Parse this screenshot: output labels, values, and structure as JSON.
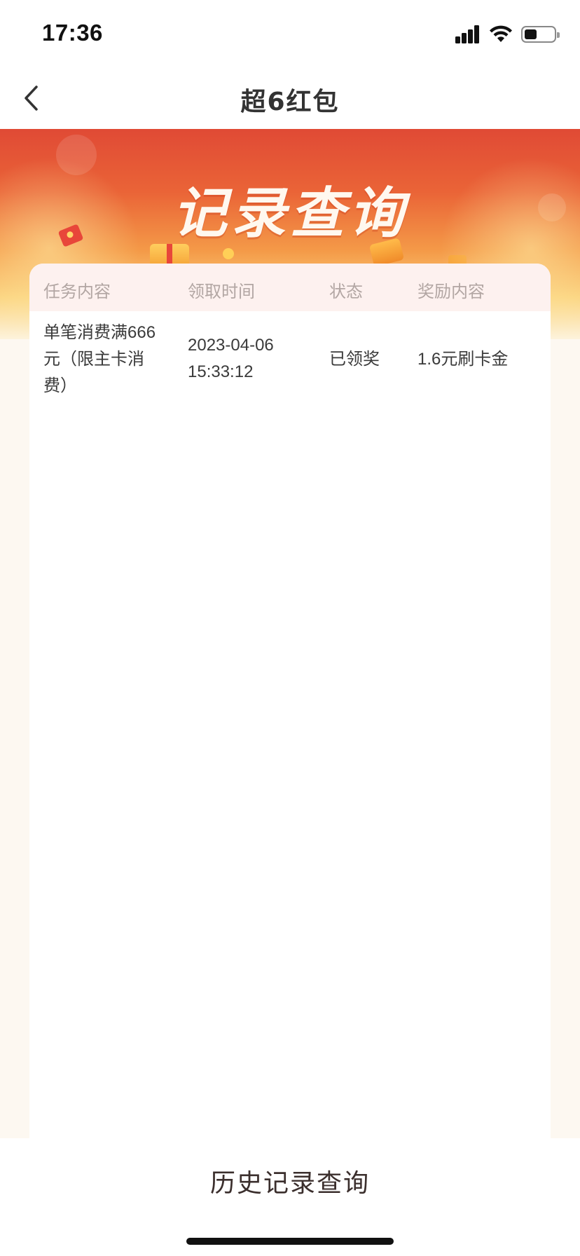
{
  "status_bar": {
    "time": "17:36",
    "icons": [
      "cellular-signal-icon",
      "wifi-icon",
      "battery-icon"
    ]
  },
  "nav": {
    "title": "超6红包",
    "back_icon": "chevron-left-icon"
  },
  "banner": {
    "title": "记录查询"
  },
  "table": {
    "headers": [
      "任务内容",
      "领取时间",
      "状态",
      "奖励内容"
    ],
    "rows": [
      {
        "task": "单笔消费满666元（限主卡消费）",
        "time": "2023-04-06 15:33:12",
        "status": "已领奖",
        "reward": "1.6元刷卡金"
      }
    ]
  },
  "footer": {
    "history_button": "历史记录查询"
  },
  "colors": {
    "banner_red": "#e04a35",
    "banner_gold": "#fbd37f",
    "header_bg": "#fdf1ef",
    "header_text": "#b2a6a3"
  }
}
